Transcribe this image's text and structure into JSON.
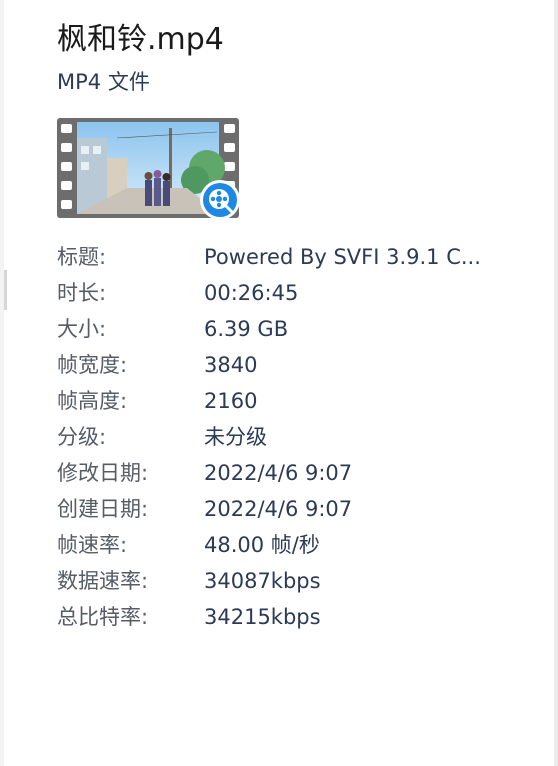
{
  "file": {
    "name": "枫和铃.mp4",
    "type_label": "MP4 文件"
  },
  "icons": {
    "thumbnail": "video-film-thumbnail-icon",
    "player_badge": "media-player-badge-icon"
  },
  "colors": {
    "badge_blue": "#1e88e5",
    "label_gray": "#555c66",
    "value_navy": "#2b3a55"
  },
  "properties": [
    {
      "label": "标题:",
      "value": "Powered By SVFI 3.9.1 C..."
    },
    {
      "label": "时长:",
      "value": "00:26:45"
    },
    {
      "label": "大小:",
      "value": "6.39 GB"
    },
    {
      "label": "帧宽度:",
      "value": "3840"
    },
    {
      "label": "帧高度:",
      "value": "2160"
    },
    {
      "label": "分级:",
      "value": "未分级"
    },
    {
      "label": "修改日期:",
      "value": "2022/4/6 9:07"
    },
    {
      "label": "创建日期:",
      "value": "2022/4/6 9:07"
    },
    {
      "label": "帧速率:",
      "value": "48.00 帧/秒"
    },
    {
      "label": "数据速率:",
      "value": "34087kbps"
    },
    {
      "label": "总比特率:",
      "value": "34215kbps"
    }
  ]
}
